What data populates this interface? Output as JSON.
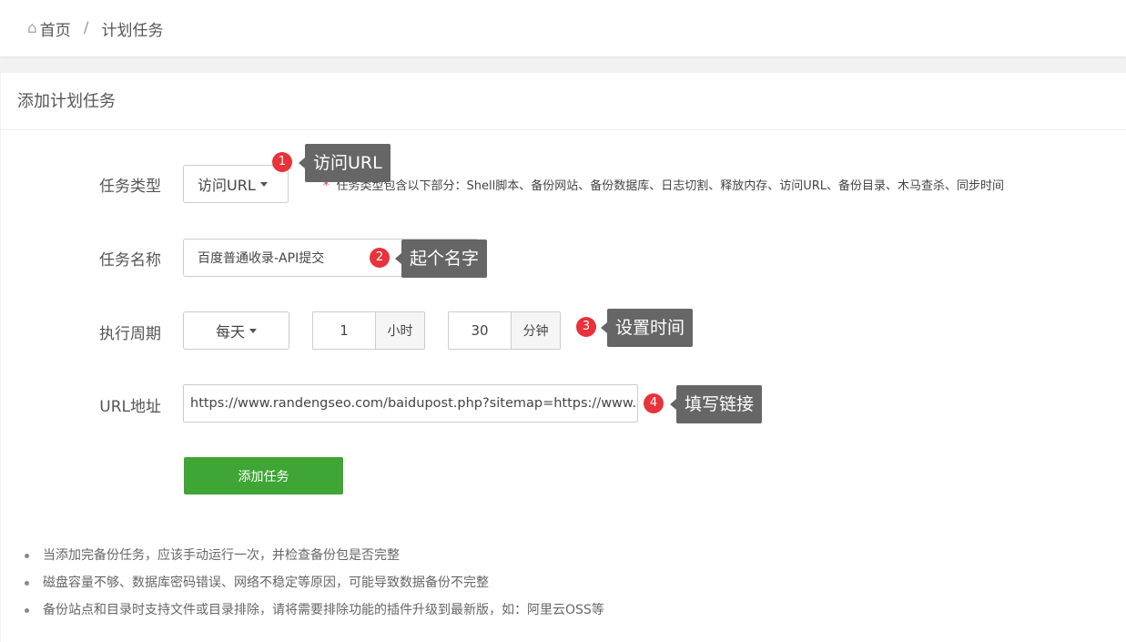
{
  "breadcrumb": {
    "home": "首页",
    "separator": "/",
    "current": "计划任务"
  },
  "card_title": "添加计划任务",
  "form": {
    "task_type": {
      "label": "任务类型",
      "value": "访问URL",
      "hint_star": "*",
      "hint": "任务类型包含以下部分：Shell脚本、备份网站、备份数据库、日志切割、释放内存、访问URL、备份目录、木马查杀、同步时间"
    },
    "task_name": {
      "label": "任务名称",
      "value": "百度普通收录-API提交"
    },
    "cycle": {
      "label": "执行周期",
      "period": "每天",
      "hour": "1",
      "hour_unit": "小时",
      "minute": "30",
      "minute_unit": "分钟"
    },
    "url": {
      "label": "URL地址",
      "value": "https://www.randengseo.com/baidupost.php?sitemap=https://www.randengseo.com/sitemap.xml"
    },
    "submit": "添加任务"
  },
  "annotations": [
    {
      "num": "1",
      "text": "访问URL"
    },
    {
      "num": "2",
      "text": "起个名字"
    },
    {
      "num": "3",
      "text": "设置时间"
    },
    {
      "num": "4",
      "text": "填写链接"
    }
  ],
  "notes": [
    "当添加完备份任务，应该手动运行一次，并检查备份包是否完整",
    "磁盘容量不够、数据库密码错误、网络不稳定等原因，可能导致数据备份不完整",
    "备份站点和目录时支持文件或目录排除，请将需要排除功能的插件升级到最新版，如：阿里云OSS等"
  ],
  "colors": {
    "submit": "#3fa535",
    "badge": "#e8323c",
    "tooltip": "#666666"
  }
}
